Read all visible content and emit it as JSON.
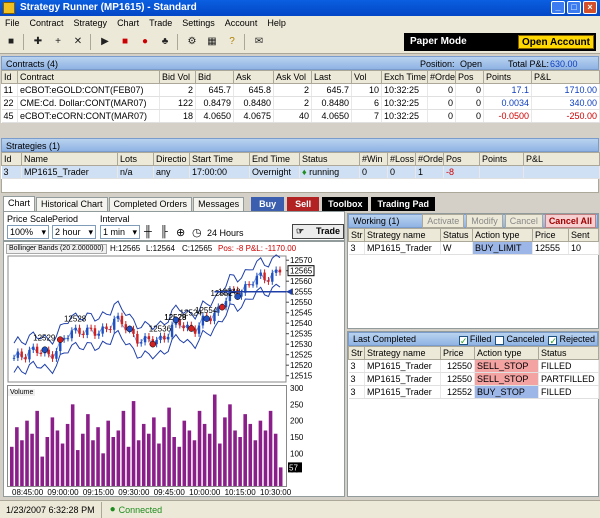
{
  "window": {
    "title": "Strategy Runner (MP1615) - Standard"
  },
  "menu": [
    "File",
    "Contract",
    "Strategy",
    "Chart",
    "Trade",
    "Settings",
    "Account",
    "Help"
  ],
  "paper": {
    "mode_label": "Paper Mode",
    "open_account_label": "Open Account"
  },
  "contracts": {
    "header": "Contracts (4)",
    "position_label": "Position:",
    "position_value": "Open",
    "total_pnl_label": "Total P&L:",
    "total_pnl_value": "630.00",
    "columns": [
      "Id",
      "Contract",
      "Bid Vol",
      "Bid",
      "Ask",
      "Ask Vol",
      "Last",
      "Vol",
      "Exch Time",
      "#Orde",
      "Pos",
      "Points",
      "P&L"
    ],
    "rows": [
      [
        "11",
        "eCBOT:eGOLD:CONT(FEB07)",
        "2",
        "645.7",
        "645.8",
        "2",
        "645.7",
        "10",
        "10:32:25",
        "0",
        "0",
        "17.1",
        "1710.00"
      ],
      [
        "22",
        "CME:Cd. Dollar:CONT(MAR07)",
        "122",
        "0.8479",
        "0.8480",
        "2",
        "0.8480",
        "6",
        "10:32:25",
        "0",
        "0",
        "0.0034",
        "340.00"
      ],
      [
        "45",
        "eCBOT:eCORN:CONT(MAR07)",
        "18",
        "4.0650",
        "4.0675",
        "40",
        "4.0650",
        "7",
        "10:32:25",
        "0",
        "0",
        "-0.0500",
        "-250.00"
      ]
    ]
  },
  "strategies": {
    "header": "Strategies (1)",
    "columns": [
      "Id",
      "Name",
      "Lots",
      "Directio",
      "Start Time",
      "End Time",
      "Status",
      "#Win",
      "#Loss",
      "#Orde",
      "Pos",
      "Points",
      "P&L"
    ],
    "rows": [
      [
        "3",
        "MP1615_Trader",
        "n/a",
        "any",
        "17:00:00",
        "Overnight",
        "running",
        "0",
        "0",
        "1",
        "-8",
        "",
        ""
      ]
    ]
  },
  "tabs": [
    "Chart",
    "Historical Chart",
    "Completed Orders",
    "Messages"
  ],
  "trade_buttons": {
    "buy": "Buy",
    "sell": "Sell",
    "toolbox": "Toolbox",
    "trading_pad": "Trading Pad"
  },
  "chart_controls": {
    "price_scale_label": "Price Scale",
    "price_scale_value": "100%",
    "period_label": "Period",
    "period_value": "2 hour",
    "interval_label": "Interval",
    "interval_value": "1 min",
    "hours_label": "24 Hours",
    "trade_label": "Trade"
  },
  "chart_info": {
    "indicator": "Bollinger Bands (20 2.000000)",
    "high": "H:12565",
    "low": "L:12564",
    "close": "C:12565",
    "pos": "Pos: -8  P&L: -1170.00",
    "volume_label": "Volume",
    "last_price_tag": "12565",
    "volume_tag": "57"
  },
  "chart_data": [
    {
      "type": "line",
      "series": [
        {
          "values": [
            12522,
            12528,
            12524,
            12532,
            12538,
            12534,
            12542,
            12536,
            12530,
            12534,
            12540,
            12537,
            12545,
            12553,
            12558,
            12562,
            12565
          ]
        }
      ],
      "x": [
        "08:45:00",
        "09:00:00",
        "09:15:00",
        "09:30:00",
        "09:45:00",
        "10:00:00",
        "10:15:00",
        "10:30:00"
      ],
      "y_ticks": [
        "12570",
        "12565",
        "12560",
        "12555",
        "12550",
        "12545",
        "12540",
        "12535",
        "12530",
        "12525",
        "12520",
        "12515"
      ],
      "ylim": [
        12512,
        12572
      ],
      "annotations": [
        "12529",
        "12528",
        "12536",
        "12529",
        "12554",
        "12552",
        "12548",
        "12528",
        "12524"
      ]
    },
    {
      "type": "bar",
      "series": [
        {
          "name": "Volume",
          "values": [
            120,
            180,
            140,
            200,
            160,
            230,
            90,
            150,
            210,
            170,
            130,
            190,
            250,
            110,
            160,
            220,
            140,
            180,
            100,
            200,
            150,
            170,
            230,
            120,
            260,
            140,
            190,
            160,
            210,
            130,
            180,
            240,
            150,
            120,
            200,
            170,
            140,
            230,
            190,
            160,
            280,
            130,
            210,
            250,
            170,
            150,
            220,
            190,
            140,
            200,
            170,
            230,
            160,
            57
          ]
        }
      ],
      "y_ticks": [
        "300",
        "250",
        "200",
        "150",
        "100",
        "50"
      ],
      "ylim": [
        0,
        300
      ]
    }
  ],
  "working": {
    "header": "Working (1)",
    "buttons": [
      "Activate",
      "Modify",
      "Cancel",
      "Cancel All"
    ],
    "columns": [
      "Str",
      "Strategy name",
      "Status",
      "Action type",
      "Price",
      "Sent"
    ],
    "rows": [
      [
        "3",
        "MP1615_Trader",
        "W",
        "BUY_LIMIT",
        "12555",
        "10"
      ]
    ]
  },
  "completed": {
    "header": "Last Completed",
    "filters": [
      "Filled",
      "Canceled",
      "Rejected"
    ],
    "columns": [
      "Str",
      "Strategy name",
      "Price",
      "Action type",
      "Status"
    ],
    "rows": [
      [
        "3",
        "MP1615_Trader",
        "12550",
        "SELL_STOP",
        "FILLED"
      ],
      [
        "3",
        "MP1615_Trader",
        "12550",
        "SELL_STOP",
        "PARTFILLED"
      ],
      [
        "3",
        "MP1615_Trader",
        "12552",
        "BUY_STOP",
        "FILLED"
      ]
    ]
  },
  "status": {
    "datetime": "1/23/2007 6:32:28 PM",
    "connection": "Connected"
  }
}
